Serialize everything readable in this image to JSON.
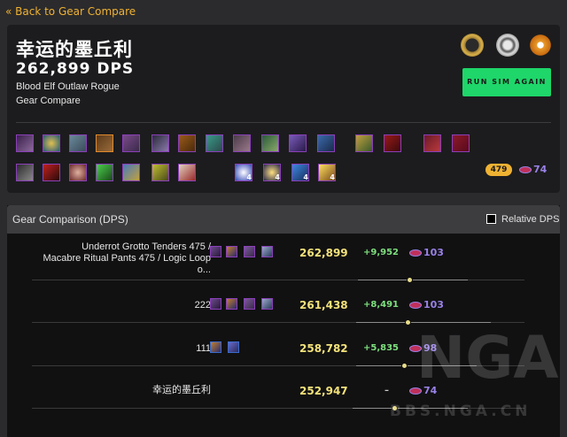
{
  "nav": {
    "back_label": "« Back to Gear Compare"
  },
  "header": {
    "character_name": "幸运的墨丘利",
    "dps": "262,899 DPS",
    "spec": "Blood Elf Outlaw Rogue",
    "mode": "Gear Compare",
    "run_button": "RUN SIM AGAIN",
    "item_level": "479",
    "gem_count": "74"
  },
  "gear_slot_counts": [
    "4",
    "4",
    "4",
    "4"
  ],
  "comparison": {
    "title": "Gear Comparison (DPS)",
    "relative_label": "Relative DPS",
    "rows": [
      {
        "name_line1": "Underrot Grotto Tenders 475 /",
        "name_line2": "Macabre Ritual Pants 475 / Logic Loop",
        "name_line3": "o...",
        "dps": "262,899",
        "diff": "+9,952",
        "gems": "103"
      },
      {
        "name": "222",
        "dps": "261,438",
        "diff": "+8,491",
        "gems": "103"
      },
      {
        "name": "111",
        "dps": "258,782",
        "diff": "+5,835",
        "gems": "98"
      },
      {
        "name": "幸运的墨丘利",
        "dps": "252,947",
        "diff": "–",
        "gems": "74"
      }
    ]
  },
  "watermark": {
    "logo": "NGA",
    "url": "BBS.NGA.CN"
  },
  "colors": {
    "accent": "#f0b232",
    "button": "#1ed66a",
    "dps": "#f3e27a",
    "positive": "#7ee07e",
    "gem": "#9a82e8"
  }
}
